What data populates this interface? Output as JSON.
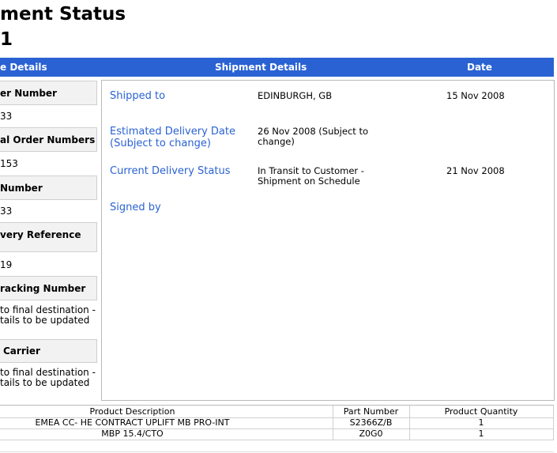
{
  "page": {
    "title": "ment Status",
    "subtitle": "1"
  },
  "header_bar": {
    "col_left": "e Details",
    "col_center": "Shipment Details",
    "col_right": "Date"
  },
  "left_panel": {
    "items": [
      {
        "label": "er Number",
        "value": "33"
      },
      {
        "label": "al Order Numbers",
        "value": "153"
      },
      {
        "label": "Number",
        "value": "33"
      },
      {
        "label": "very Reference",
        "value": "19"
      },
      {
        "label": "racking Number",
        "value_line1": "to final destination -",
        "value_line2": "tails to be updated"
      },
      {
        "label": "Carrier",
        "value_line1": "to final destination -",
        "value_line2": "tails to be updated"
      }
    ]
  },
  "shipment_details": [
    {
      "label": "Shipped to",
      "value": "EDINBURGH, GB",
      "date": "15 Nov 2008"
    },
    {
      "label_line1": "Estimated Delivery Date",
      "label_line2": "(Subject to change)",
      "value_line1": "26 Nov 2008 (Subject to",
      "value_line2": "change)",
      "date": ""
    },
    {
      "label": "Current Delivery Status",
      "value_line1": "In Transit to Customer -",
      "value_line2": "Shipment on Schedule",
      "date": "21 Nov 2008"
    },
    {
      "label": "Signed by",
      "value": "",
      "date": ""
    }
  ],
  "product_table": {
    "headers": [
      "Product Description",
      "Part Number",
      "Product Quantity"
    ],
    "rows": [
      [
        "EMEA CC- HE CONTRACT UPLIFT MB PRO-INT",
        "S2366Z/B",
        "1"
      ],
      [
        "MBP 15.4/CTO",
        "Z0G0",
        "1"
      ]
    ]
  }
}
